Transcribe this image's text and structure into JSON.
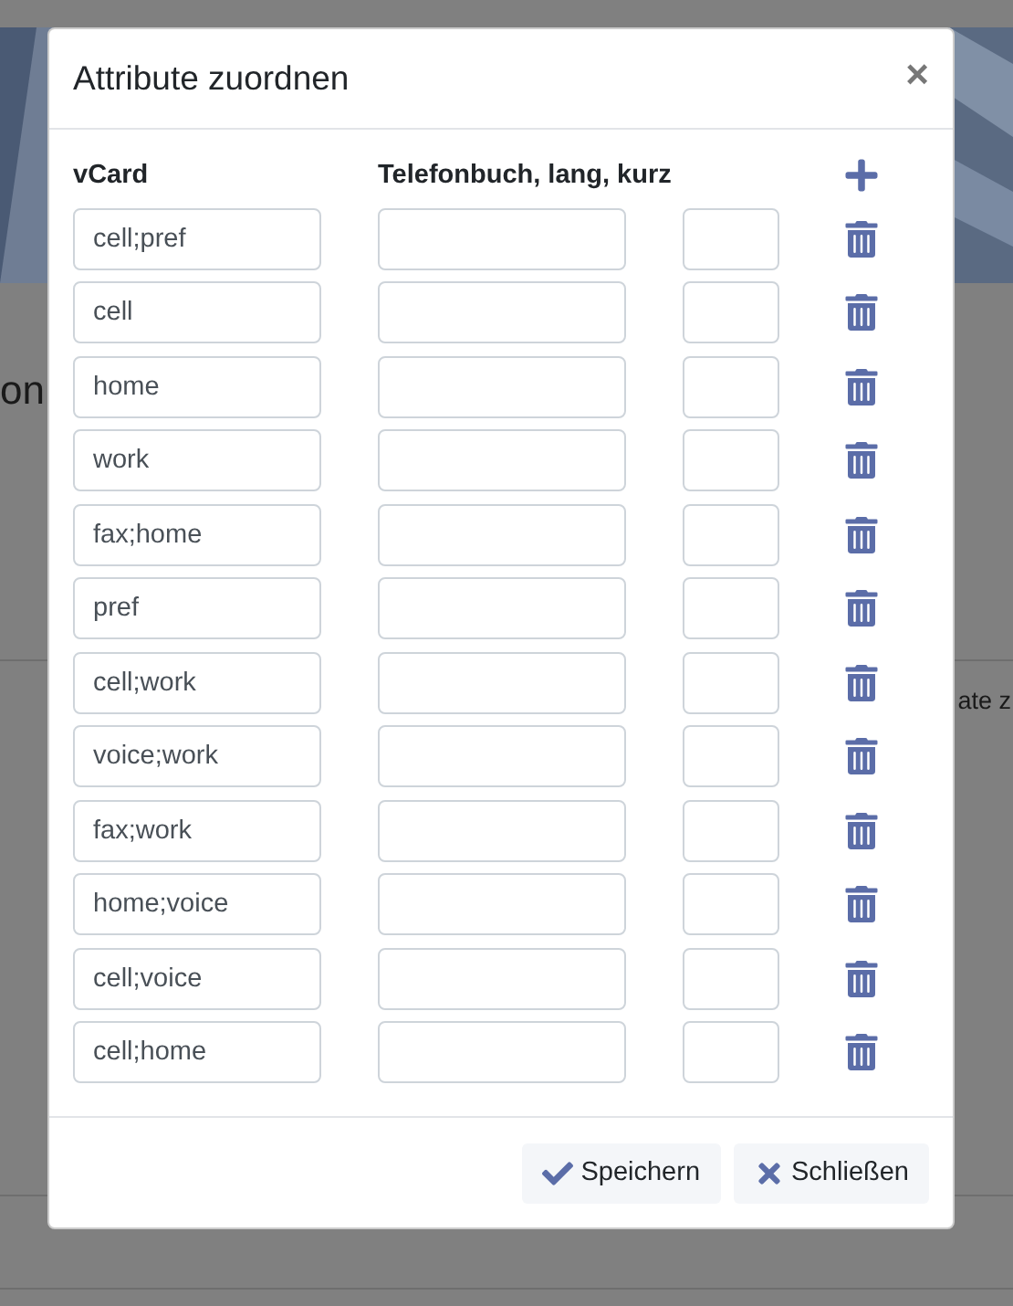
{
  "background": {
    "heading_fragment": "on",
    "text_fragment": "ate z"
  },
  "dialog": {
    "title": "Attribute zuordnen",
    "close": "×",
    "columns": [
      "vCard",
      "Telefonbuch, lang, kurz"
    ],
    "rows": [
      {
        "vcard": "cell;pref"
      },
      {
        "vcard": "cell"
      },
      {
        "vcard": "home"
      },
      {
        "vcard": "work"
      },
      {
        "vcard": "fax;home"
      },
      {
        "vcard": "pref"
      },
      {
        "vcard": "cell;work"
      },
      {
        "vcard": "voice;work"
      },
      {
        "vcard": "fax;work"
      },
      {
        "vcard": "home;voice"
      },
      {
        "vcard": "cell;voice"
      },
      {
        "vcard": "cell;home"
      }
    ],
    "buttons": [
      {
        "kind": "save",
        "label": "Speichern"
      },
      {
        "kind": "close",
        "label": "Schließen"
      }
    ]
  }
}
